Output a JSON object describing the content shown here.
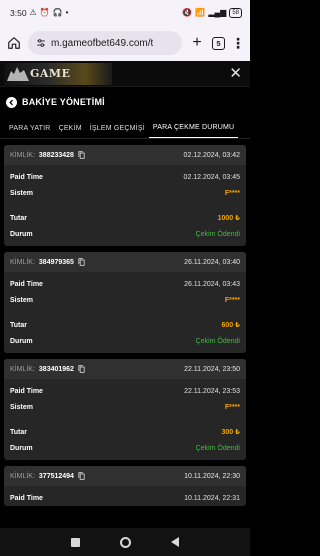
{
  "status_bar": {
    "time": "3:50",
    "battery": "58"
  },
  "browser": {
    "url": "m.gameofbet649.com/t",
    "tab_count": "5"
  },
  "site": {
    "logo_text": "GAME"
  },
  "page": {
    "title": "BAKİYE YÖNETİMİ",
    "tabs": [
      {
        "label": "PARA YATIR",
        "active": false
      },
      {
        "label": "ÇEKİM",
        "active": false
      },
      {
        "label": "İŞLEM GEÇMİŞİ",
        "active": false
      },
      {
        "label": "PARA ÇEKME DURUMU",
        "active": true
      }
    ]
  },
  "labels": {
    "kimlik": "KİMLİK:",
    "paid_time": "Paid Time",
    "sistem": "Sistem",
    "tutar": "Tutar",
    "durum": "Durum"
  },
  "withdrawals": [
    {
      "id": "388233428",
      "created": "02.12.2024, 03:42",
      "paid_time": "02.12.2024, 03:45",
      "sistem": "F****",
      "tutar": "1000 ₺",
      "durum": "Çekim Ödendi"
    },
    {
      "id": "384979365",
      "created": "26.11.2024, 03:40",
      "paid_time": "26.11.2024, 03:43",
      "sistem": "F****",
      "tutar": "600 ₺",
      "durum": "Çekim Ödendi"
    },
    {
      "id": "383401962",
      "created": "22.11.2024, 23:50",
      "paid_time": "22.11.2024, 23:53",
      "sistem": "F****",
      "tutar": "300 ₺",
      "durum": "Çekim Ödendi"
    },
    {
      "id": "377512494",
      "created": "10.11.2024, 22:30",
      "paid_time": "10.11.2024, 22:31"
    }
  ],
  "colors": {
    "amount": "#f0a400",
    "status_paid": "#3dbd3d",
    "card_bg": "#262626"
  }
}
